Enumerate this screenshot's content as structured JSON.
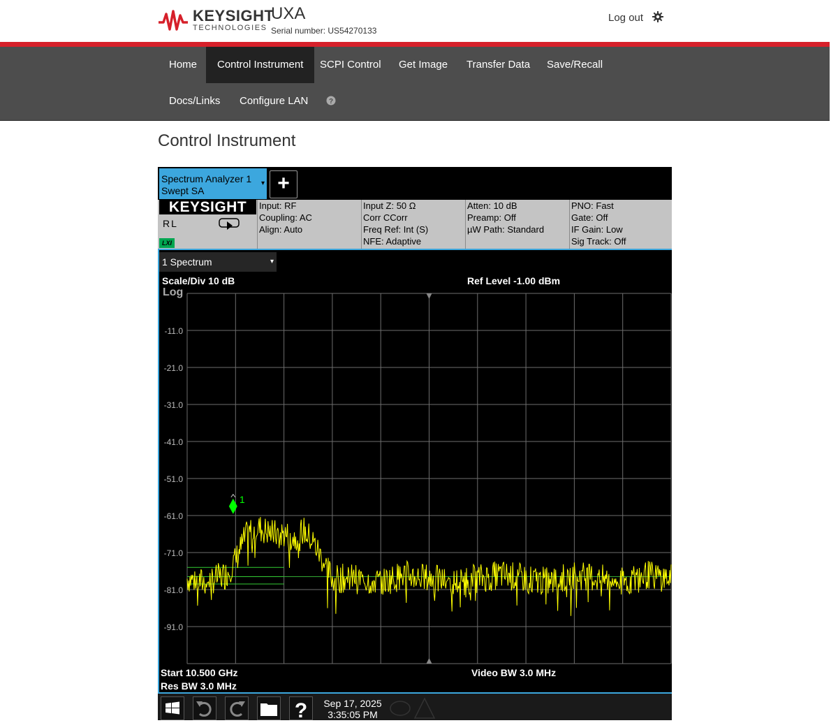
{
  "header": {
    "brand_name": "KEYSIGHT",
    "brand_sub": "TECHNOLOGIES",
    "product": "UXA",
    "serial": "Serial number: US54270133",
    "logout": "Log out",
    "settings_icon": "gear-icon"
  },
  "nav": {
    "items": [
      "Home",
      "Control Instrument",
      "SCPI Control",
      "Get Image",
      "Transfer Data",
      "Save/Recall",
      "Docs/Links",
      "Configure LAN"
    ],
    "active": "Control Instrument",
    "help_icon": "question-circle-icon"
  },
  "page": {
    "title": "Control Instrument"
  },
  "instrument": {
    "tab": {
      "line1": "Spectrum Analyzer 1",
      "line2": "Swept SA",
      "caret": "▾"
    },
    "add_tab_label": "+",
    "badge": "KEYSIGHT",
    "rl": "RL",
    "lxi": "LXI",
    "settings_columns": [
      [
        "Input: RF",
        "Coupling: AC",
        "Align: Auto"
      ],
      [
        "Input Z: 50 Ω",
        "Corr CCorr",
        "Freq Ref: Int (S)",
        "NFE: Adaptive"
      ],
      [
        "Atten: 10 dB",
        "Preamp: Off",
        "µW Path: Standard"
      ],
      [
        "PNO: Fast",
        "Gate: Off",
        "IF Gain: Low",
        "Sig Track: Off"
      ]
    ],
    "window_select": {
      "label": "1 Spectrum",
      "caret": "▾"
    },
    "scale": "Scale/Div 10 dB",
    "ref_level": "Ref Level -1.00 dBm",
    "scale_type": "Log",
    "start": "Start 10.500 GHz",
    "res_bw": "Res BW 3.0 MHz",
    "video_bw": "Video BW 3.0 MHz",
    "marker_label": "1",
    "date": "Sep 17, 2025",
    "time": "3:35:05 PM",
    "toolbar_icons": [
      "windows-icon",
      "undo-icon",
      "redo-icon",
      "folder-icon",
      "help-icon"
    ],
    "colors": {
      "trace": "#ffff00",
      "marker": "#00ff00",
      "accent": "#3ca7de",
      "brand_red": "#d6202a"
    }
  },
  "chart_data": {
    "type": "line",
    "y_tick_labels": [
      "-11.0",
      "-21.0",
      "-31.0",
      "-41.0",
      "-51.0",
      "-61.0",
      "-71.0",
      "-81.0",
      "-91.0"
    ],
    "ylim": [
      -101,
      -1
    ],
    "xlim": [
      0,
      10
    ],
    "grid": true,
    "series": [
      {
        "x": [
          0,
          0.3,
          0.6,
          0.8,
          1.0,
          1.2,
          1.4,
          1.6,
          1.8,
          2.0,
          2.2,
          2.4,
          2.6,
          2.8,
          3.0,
          3.5,
          4.0,
          4.5,
          5.0,
          5.5,
          6.0,
          6.5,
          7.0,
          7.5,
          8.0,
          8.5,
          9.0,
          9.5,
          10.0
        ],
        "y": [
          -78,
          -79,
          -78,
          -77,
          -73,
          -67,
          -64,
          -65,
          -66,
          -66,
          -67,
          -65,
          -68,
          -73,
          -78,
          -78,
          -79,
          -77,
          -78,
          -79,
          -78,
          -77,
          -78,
          -79,
          -77,
          -78,
          -79,
          -77,
          -78
        ]
      }
    ],
    "marker": {
      "label": "1",
      "x": 0.95,
      "y": -58.5
    }
  }
}
